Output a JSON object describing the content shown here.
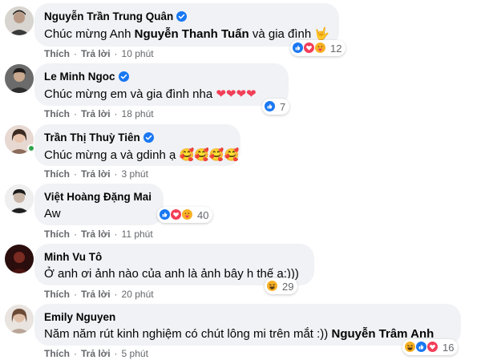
{
  "actions": {
    "like": "Thích",
    "reply": "Trả lời",
    "separator": "·"
  },
  "colors": {
    "verified": "#1877f2",
    "like": "#1877f2",
    "love": "#f33e58",
    "care": "#f7b125",
    "haha": "#f7b125",
    "bubble": "#f0f2f5",
    "meta": "#65676b"
  },
  "comments": [
    {
      "name": "Nguyễn Trần Trung Quân",
      "verified": true,
      "text_before": "Chúc mừng Anh ",
      "mention": "Nguyễn Thanh Tuấn",
      "text_after": " và gia đình ",
      "emoji": "🤟",
      "time": "10 phút",
      "reactions": [
        "like",
        "love",
        "care"
      ],
      "reaction_count": "12"
    },
    {
      "name": "Le Minh Ngoc",
      "verified": true,
      "text_before": "Chúc mừng em và gia đình nha ",
      "emoji": "❤❤❤❤",
      "time": "18 phút",
      "reactions": [
        "like"
      ],
      "reaction_count": "7"
    },
    {
      "name": "Trần Thị Thuỳ Tiên",
      "verified": true,
      "online": true,
      "text_before": "Chúc mừng a và gdinh ạ ",
      "emoji": "🥰🥰🥰🥰",
      "time": "3 phút"
    },
    {
      "name": "Việt Hoàng Đặng Mai",
      "verified": false,
      "text_before": "Aw",
      "time": "11 phút",
      "reactions": [
        "like",
        "love",
        "care"
      ],
      "reaction_count": "40"
    },
    {
      "name": "Minh Vu Tô",
      "verified": false,
      "text_before": "Ở anh ơi ảnh nào của anh là ảnh bây h thế ạ:)))",
      "time": "20 phút",
      "reactions": [
        "haha"
      ],
      "reaction_count": "29"
    },
    {
      "name": "Emily Nguyen",
      "verified": false,
      "text_before": "Năm năm rút kinh nghiệm có chút lông mi trên mắt :)) ",
      "mention": "Nguyễn Trâm Anh",
      "time": "5 phút",
      "reactions": [
        "haha",
        "like",
        "love"
      ],
      "reaction_count": "16"
    }
  ]
}
